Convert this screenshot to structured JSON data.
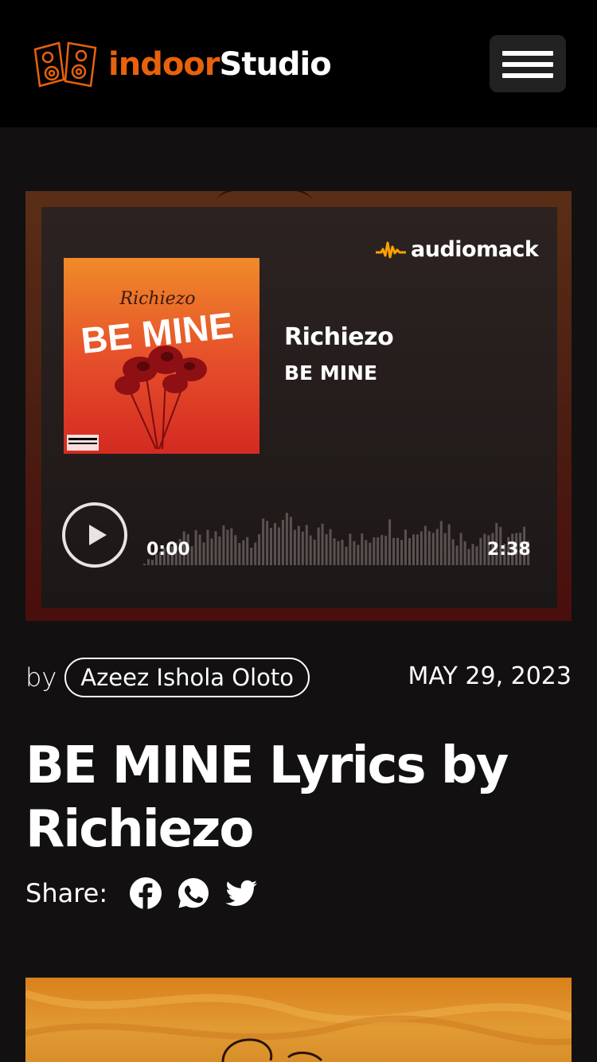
{
  "header": {
    "logo_part1": "indoor",
    "logo_part2": "Studio",
    "menu_icon": "hamburger-icon"
  },
  "player": {
    "brand": "audiomack",
    "artist": "Richiezo",
    "title": "BE MINE",
    "cover_art": {
      "script_text": "Richiezo",
      "title_text": "BE MINE"
    },
    "time_current": "0:00",
    "time_total": "2:38",
    "play_icon": "play-icon"
  },
  "post": {
    "by_label": "by",
    "author": "Azeez Ishola Oloto",
    "date": "MAY 29, 2023",
    "title": "BE MINE Lyrics by Richiezo",
    "share_label": "Share:",
    "share_icons": [
      "facebook-icon",
      "whatsapp-icon",
      "twitter-icon"
    ]
  },
  "colors": {
    "brand_orange": "#e8620c",
    "audiomack_orange": "#ffa200",
    "background": "#121011"
  }
}
